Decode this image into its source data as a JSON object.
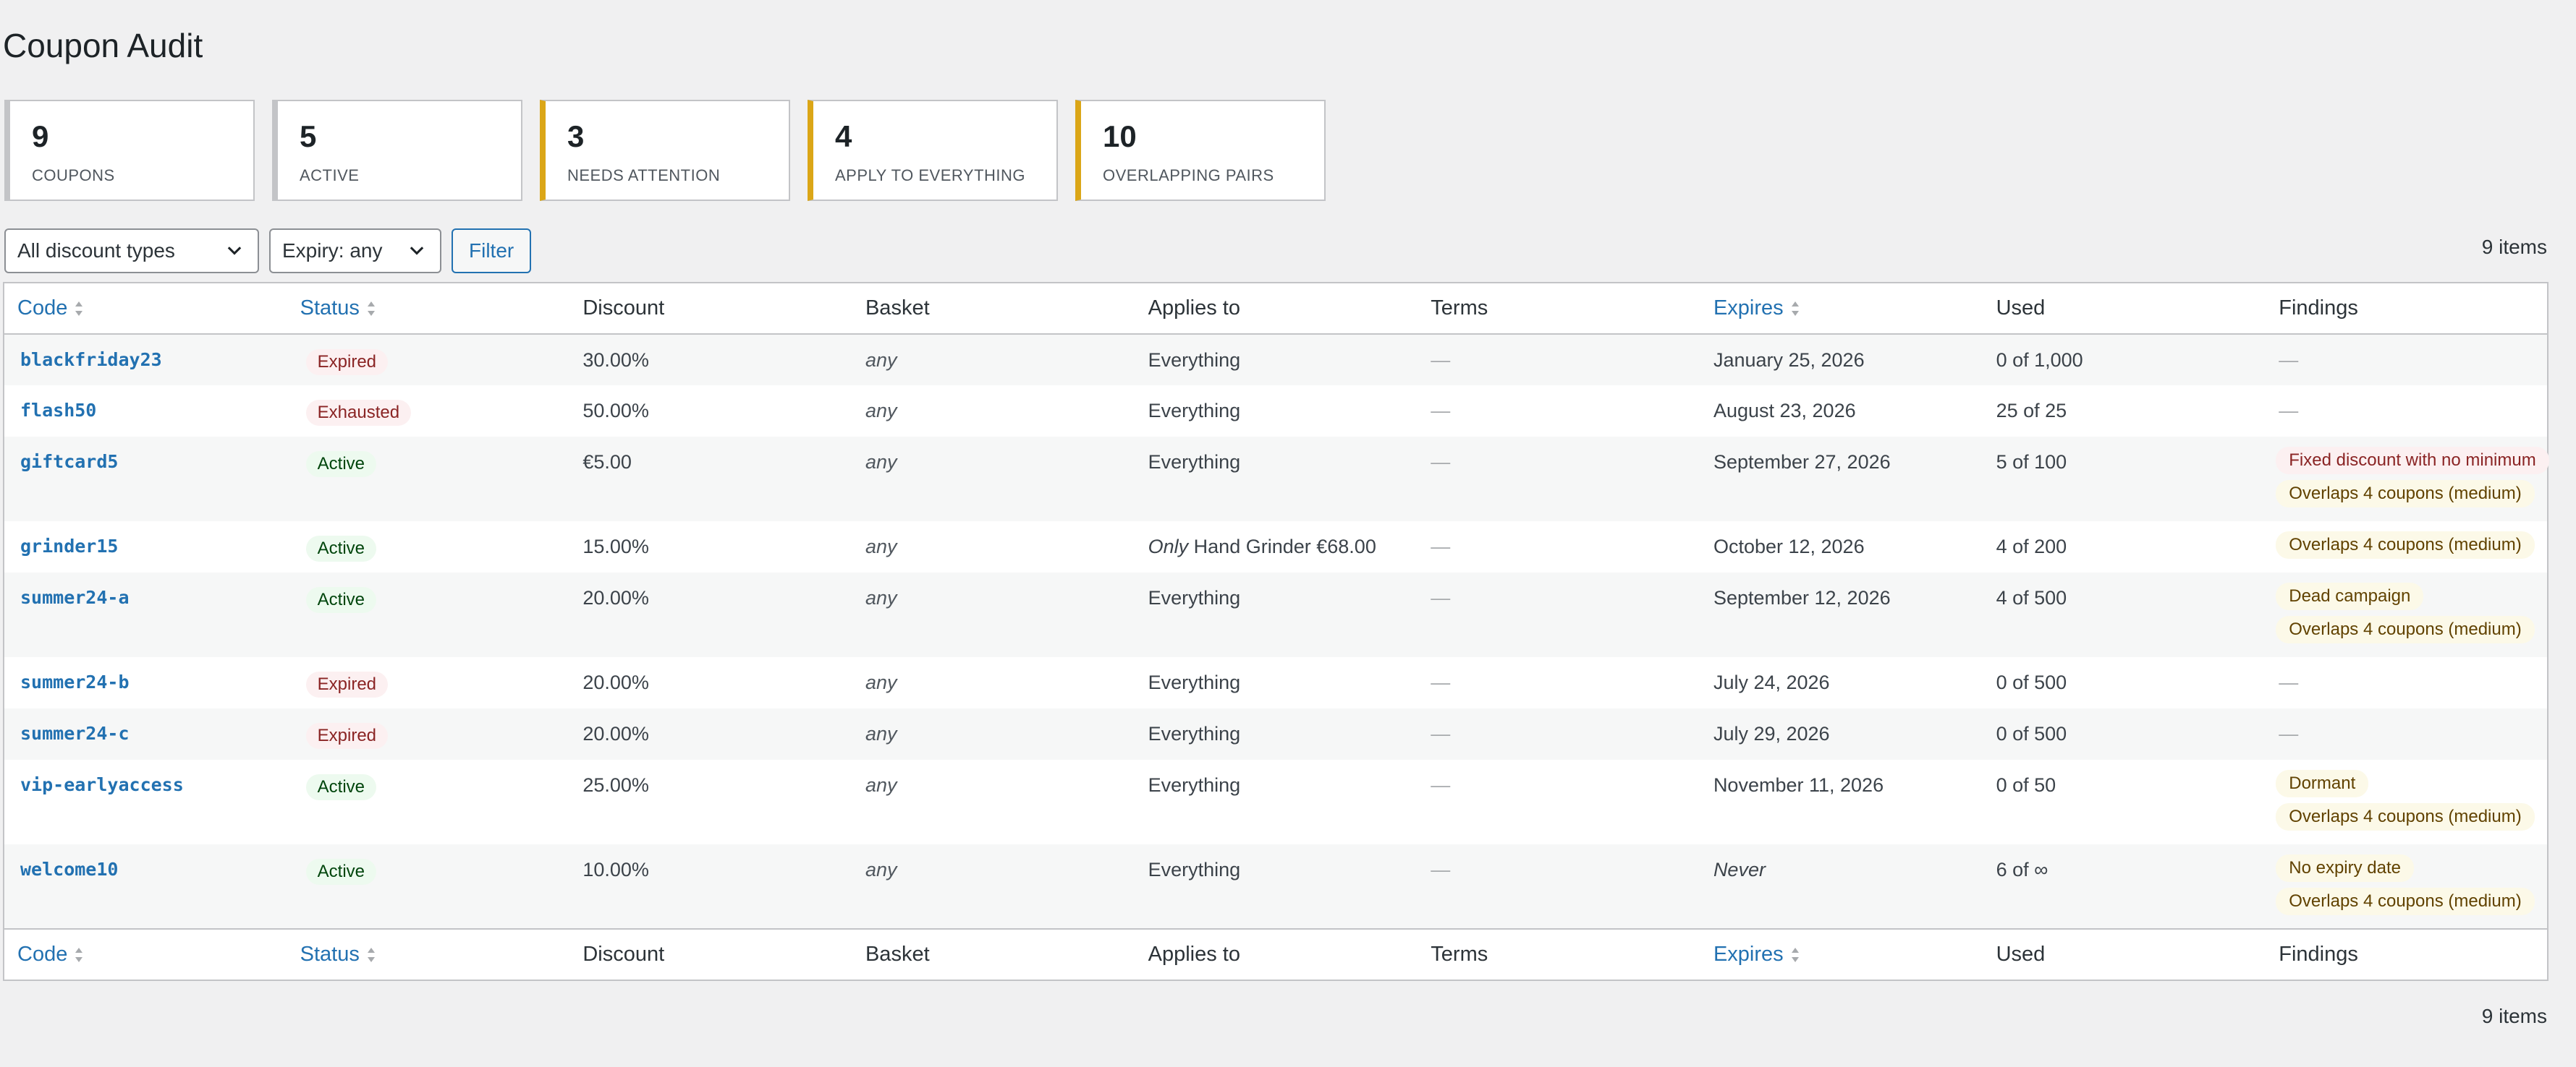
{
  "page": {
    "title": "Coupon Audit"
  },
  "cards": [
    {
      "value": "9",
      "label": "COUPONS",
      "warn": false
    },
    {
      "value": "5",
      "label": "ACTIVE",
      "warn": false
    },
    {
      "value": "3",
      "label": "NEEDS ATTENTION",
      "warn": true
    },
    {
      "value": "4",
      "label": "APPLY TO EVERYTHING",
      "warn": true
    },
    {
      "value": "10",
      "label": "OVERLAPPING PAIRS",
      "warn": true
    }
  ],
  "filters": {
    "discount_types": "All discount types",
    "expiry": "Expiry: any",
    "filter_button": "Filter"
  },
  "items_count": "9 items",
  "columns": {
    "code": "Code",
    "status": "Status",
    "discount": "Discount",
    "basket": "Basket",
    "applies_to": "Applies to",
    "terms": "Terms",
    "expires": "Expires",
    "used": "Used",
    "findings": "Findings"
  },
  "rows": [
    {
      "code": "blackfriday23",
      "status": "Expired",
      "status_kind": "expired",
      "discount": "30.00%",
      "basket": "any",
      "applies_to": "Everything",
      "terms": "—",
      "expires": "January 25, 2026",
      "used": "0 of 1,000",
      "findings": []
    },
    {
      "code": "flash50",
      "status": "Exhausted",
      "status_kind": "exhausted",
      "discount": "50.00%",
      "basket": "any",
      "applies_to": "Everything",
      "terms": "—",
      "expires": "August 23, 2026",
      "used": "25 of 25",
      "findings": []
    },
    {
      "code": "giftcard5",
      "status": "Active",
      "status_kind": "active",
      "discount": "€5.00",
      "basket": "any",
      "applies_to": "Everything",
      "terms": "—",
      "expires": "September 27, 2026",
      "used": "5 of 100",
      "findings": [
        {
          "text": "Fixed discount with no minimum",
          "kind": "red"
        },
        {
          "text": "Overlaps 4 coupons (medium)",
          "kind": "amber"
        }
      ]
    },
    {
      "code": "grinder15",
      "status": "Active",
      "status_kind": "active",
      "discount": "15.00%",
      "basket": "any",
      "applies_to_prefix": "Only",
      "applies_to": "Hand Grinder €68.00",
      "terms": "—",
      "expires": "October 12, 2026",
      "used": "4 of 200",
      "findings": [
        {
          "text": "Overlaps 4 coupons (medium)",
          "kind": "amber"
        }
      ]
    },
    {
      "code": "summer24-a",
      "status": "Active",
      "status_kind": "active",
      "discount": "20.00%",
      "basket": "any",
      "applies_to": "Everything",
      "terms": "—",
      "expires": "September 12, 2026",
      "used": "4 of 500",
      "findings": [
        {
          "text": "Dead campaign",
          "kind": "amber"
        },
        {
          "text": "Overlaps 4 coupons (medium)",
          "kind": "amber"
        }
      ]
    },
    {
      "code": "summer24-b",
      "status": "Expired",
      "status_kind": "expired",
      "discount": "20.00%",
      "basket": "any",
      "applies_to": "Everything",
      "terms": "—",
      "expires": "July 24, 2026",
      "used": "0 of 500",
      "findings": []
    },
    {
      "code": "summer24-c",
      "status": "Expired",
      "status_kind": "expired",
      "discount": "20.00%",
      "basket": "any",
      "applies_to": "Everything",
      "terms": "—",
      "expires": "July 29, 2026",
      "used": "0 of 500",
      "findings": []
    },
    {
      "code": "vip-earlyaccess",
      "status": "Active",
      "status_kind": "active",
      "discount": "25.00%",
      "basket": "any",
      "applies_to": "Everything",
      "terms": "—",
      "expires": "November 11, 2026",
      "used": "0 of 50",
      "findings": [
        {
          "text": "Dormant",
          "kind": "amber"
        },
        {
          "text": "Overlaps 4 coupons (medium)",
          "kind": "amber"
        }
      ]
    },
    {
      "code": "welcome10",
      "status": "Active",
      "status_kind": "active",
      "discount": "10.00%",
      "basket": "any",
      "applies_to": "Everything",
      "terms": "—",
      "expires": "Never",
      "expires_italic": true,
      "used": "6 of ∞",
      "findings": [
        {
          "text": "No expiry date",
          "kind": "amber"
        },
        {
          "text": "Overlaps 4 coupons (medium)",
          "kind": "amber"
        }
      ]
    }
  ],
  "empty_finding": "—"
}
